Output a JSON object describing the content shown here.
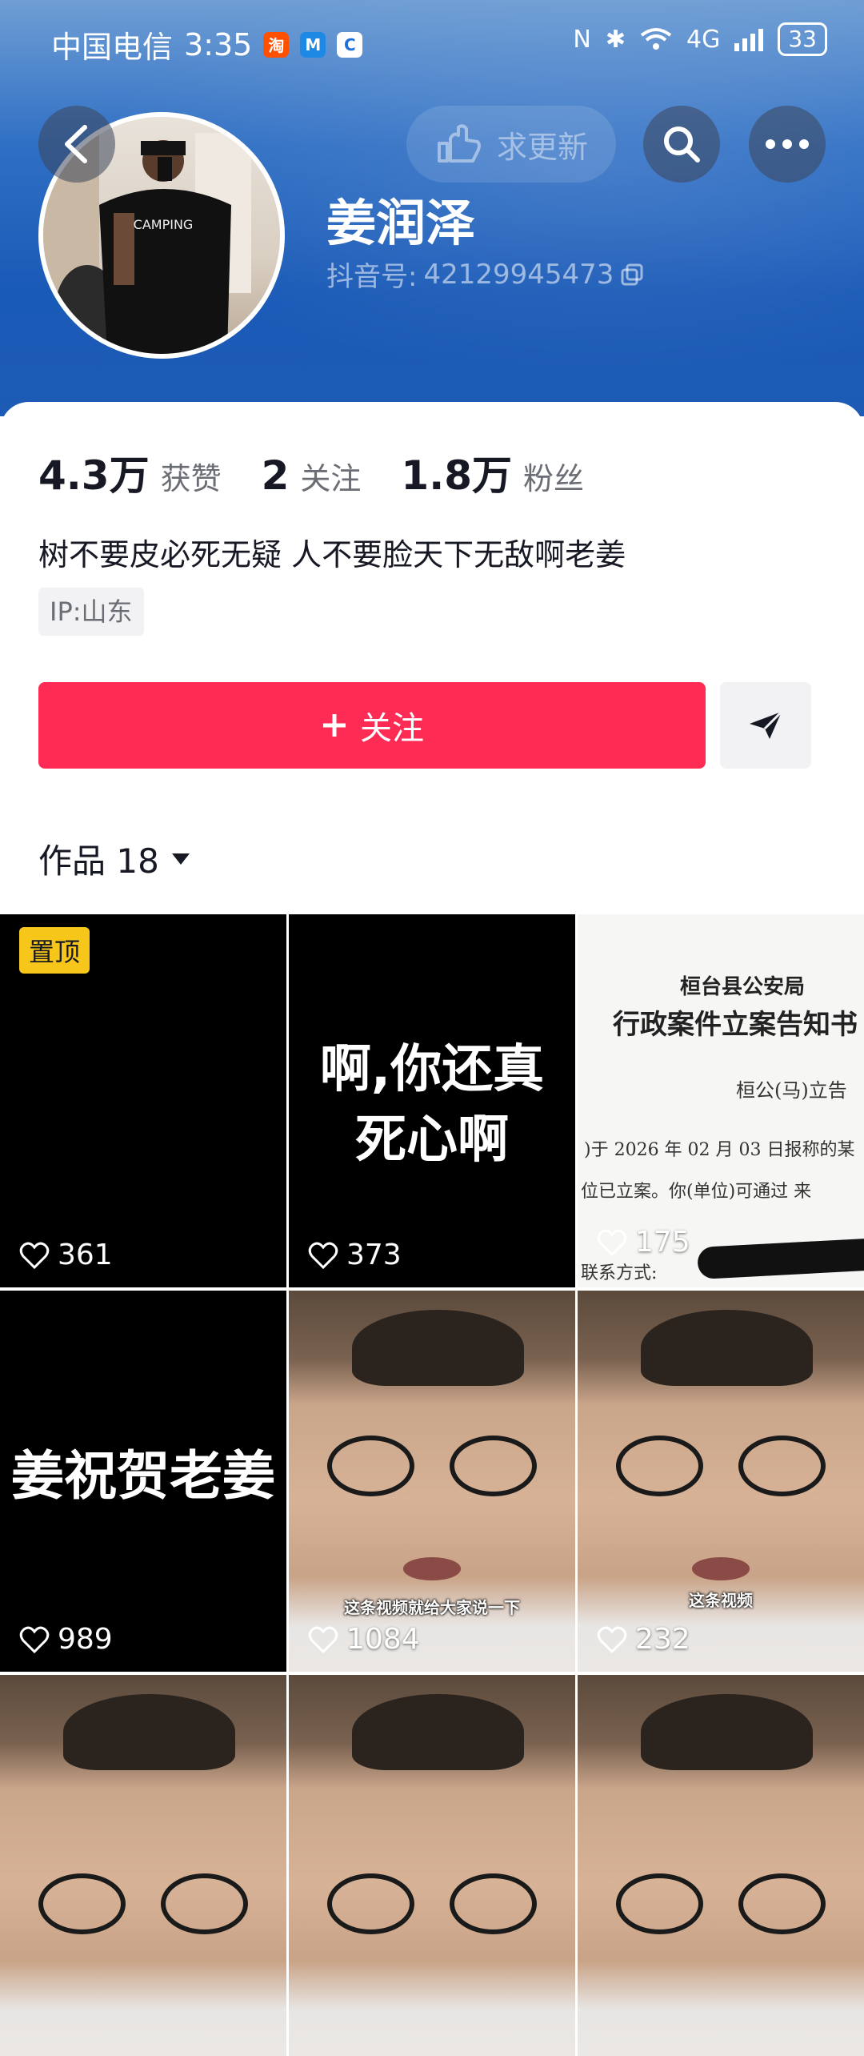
{
  "status": {
    "carrier": "中国电信",
    "time": "3:35",
    "network": "4G",
    "battery": "33"
  },
  "header": {
    "update_label": "求更新"
  },
  "profile": {
    "name": "姜润泽",
    "douyin_id_label": "抖音号:",
    "douyin_id": "42129945473",
    "likes_count": "4.3万",
    "likes_label": "获赞",
    "following_count": "2",
    "following_label": "关注",
    "followers_count": "1.8万",
    "followers_label": "粉丝",
    "bio": "树不要皮必死无疑 人不要脸天下无敌啊老姜",
    "ip": "IP:山东"
  },
  "actions": {
    "follow_label": "关注"
  },
  "works": {
    "label": "作品 18"
  },
  "videos": [
    {
      "pinned": "置顶",
      "likes": "361"
    },
    {
      "overlay_text": "啊,你还真死心啊",
      "likes": "373"
    },
    {
      "doc_org": "桓台县公安局",
      "doc_title": "行政案件立案告知书",
      "doc_code": "桓公(马)立告",
      "doc_line1": ")于 2026 年 02 月 03 日报称的某",
      "doc_line2": "位已立案。你(单位)可通过 来",
      "doc_line3": "联系方式:",
      "likes": "175"
    },
    {
      "overlay_text": "姜祝贺老姜",
      "likes": "989"
    },
    {
      "caption": "这条视频就给大家说一下",
      "likes": "1084"
    },
    {
      "caption": "这条视频",
      "likes": "232"
    },
    {
      "likes": ""
    },
    {
      "likes": ""
    },
    {
      "likes": ""
    }
  ]
}
